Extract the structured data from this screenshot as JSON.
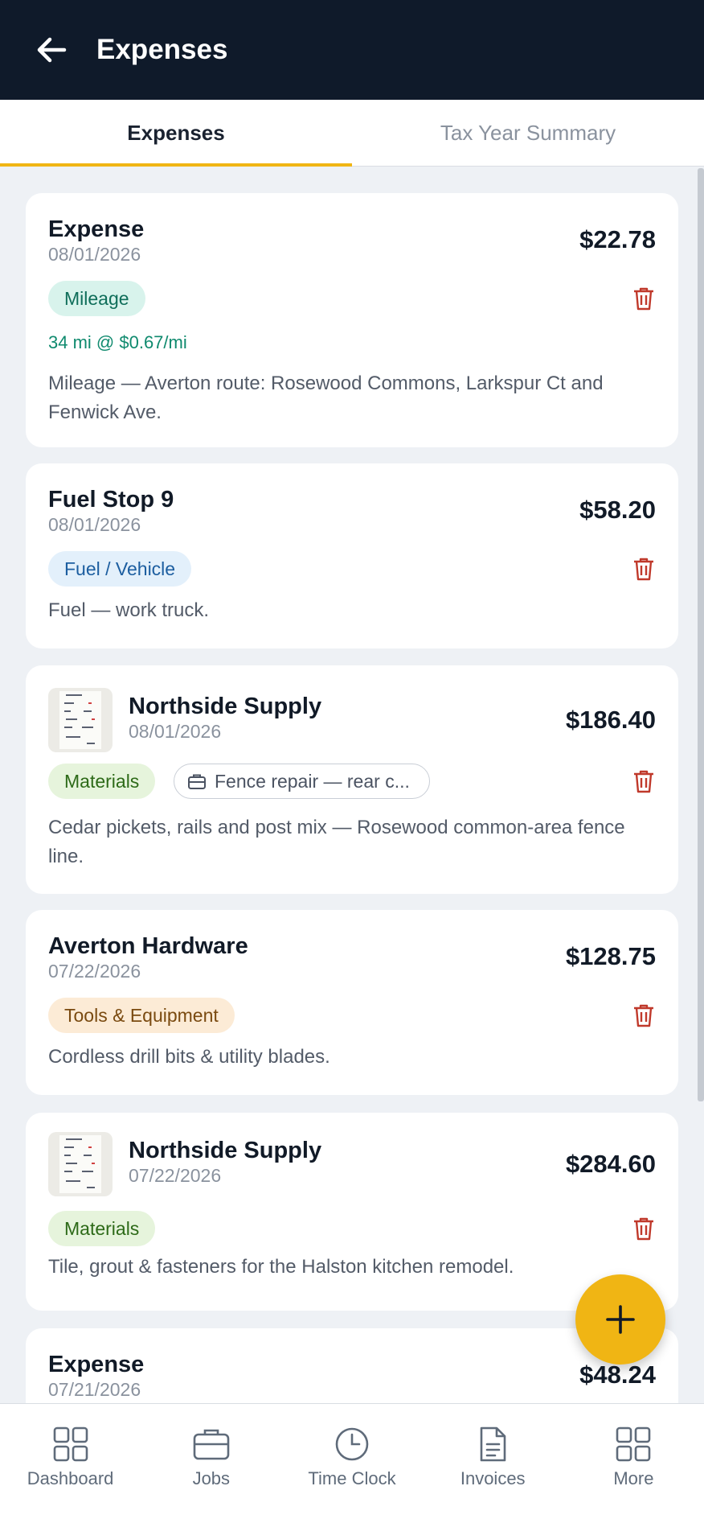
{
  "header": {
    "title": "Expenses"
  },
  "tabs": [
    {
      "label": "Expenses",
      "active": true
    },
    {
      "label": "Tax Year Summary",
      "active": false
    }
  ],
  "expenses": [
    {
      "title": "Expense",
      "date": "08/01/2026",
      "amount": "$22.78",
      "category": "Mileage",
      "mileage_detail": "34 mi @ $0.67/mi",
      "note": "Mileage — Averton route: Rosewood Commons, Larkspur Ct and Fenwick Ave."
    },
    {
      "title": "Fuel Stop 9",
      "date": "08/01/2026",
      "amount": "$58.20",
      "category": "Fuel / Vehicle",
      "note": "Fuel — work truck."
    },
    {
      "title": "Northside Supply",
      "date": "08/01/2026",
      "amount": "$186.40",
      "category": "Materials",
      "job": "Fence repair — rear c...",
      "note": "Cedar pickets, rails and post mix — Rosewood common-area fence line."
    },
    {
      "title": "Averton Hardware",
      "date": "07/22/2026",
      "amount": "$128.75",
      "category": "Tools & Equipment",
      "note": "Cordless drill bits & utility blades."
    },
    {
      "title": "Northside Supply",
      "date": "07/22/2026",
      "amount": "$284.60",
      "category": "Materials",
      "note": "Tile, grout & fasteners for the Halston kitchen remodel."
    },
    {
      "title": "Expense",
      "date": "07/21/2026",
      "amount": "$48.24"
    }
  ],
  "nav": [
    {
      "label": "Dashboard",
      "icon": "grid-icon"
    },
    {
      "label": "Jobs",
      "icon": "briefcase-icon"
    },
    {
      "label": "Time Clock",
      "icon": "clock-icon"
    },
    {
      "label": "Invoices",
      "icon": "document-icon"
    },
    {
      "label": "More",
      "icon": "grid-icon"
    }
  ],
  "colors": {
    "header_bg": "#0f1a2a",
    "accent": "#f0b514",
    "delete": "#c0392b"
  }
}
